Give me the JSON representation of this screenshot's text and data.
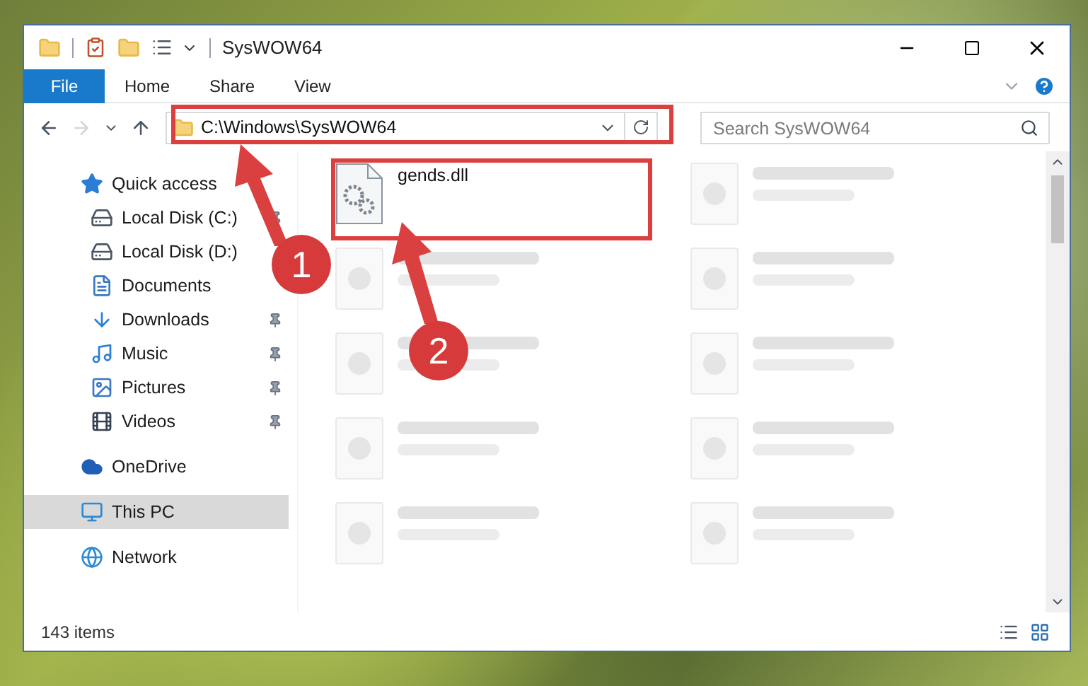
{
  "window": {
    "title": "SysWOW64"
  },
  "ribbon_tabs": [
    {
      "label": "File",
      "selected": true
    },
    {
      "label": "Home",
      "selected": false
    },
    {
      "label": "Share",
      "selected": false
    },
    {
      "label": "View",
      "selected": false
    }
  ],
  "navigation": {
    "forward_disabled": true
  },
  "address_bar": {
    "value": "C:\\Windows\\SysWOW64"
  },
  "search": {
    "placeholder": "Search SysWOW64"
  },
  "sidebar": {
    "items": [
      {
        "label": "Quick access",
        "kind": "star",
        "selected": false,
        "children": [
          {
            "label": "Local Disk (C:)",
            "kind": "drive",
            "pinned": true,
            "selected": false
          },
          {
            "label": "Local Disk (D:)",
            "kind": "drive",
            "pinned": false,
            "selected": false
          },
          {
            "label": "Documents",
            "kind": "document",
            "pinned": false,
            "selected": false
          },
          {
            "label": "Downloads",
            "kind": "download",
            "pinned": true,
            "selected": false
          },
          {
            "label": "Music",
            "kind": "music",
            "pinned": true,
            "selected": false
          },
          {
            "label": "Pictures",
            "kind": "picture",
            "pinned": true,
            "selected": false
          },
          {
            "label": "Videos",
            "kind": "video",
            "pinned": true,
            "selected": false
          }
        ]
      },
      {
        "label": "OneDrive",
        "kind": "cloud",
        "selected": false
      },
      {
        "label": "This PC",
        "kind": "computer",
        "selected": true
      },
      {
        "label": "Network",
        "kind": "network",
        "selected": false
      }
    ]
  },
  "files": [
    {
      "name": "gends.dll"
    }
  ],
  "status_bar": {
    "item_count": "143 items"
  },
  "annotations": [
    {
      "number": "1"
    },
    {
      "number": "2"
    }
  ]
}
